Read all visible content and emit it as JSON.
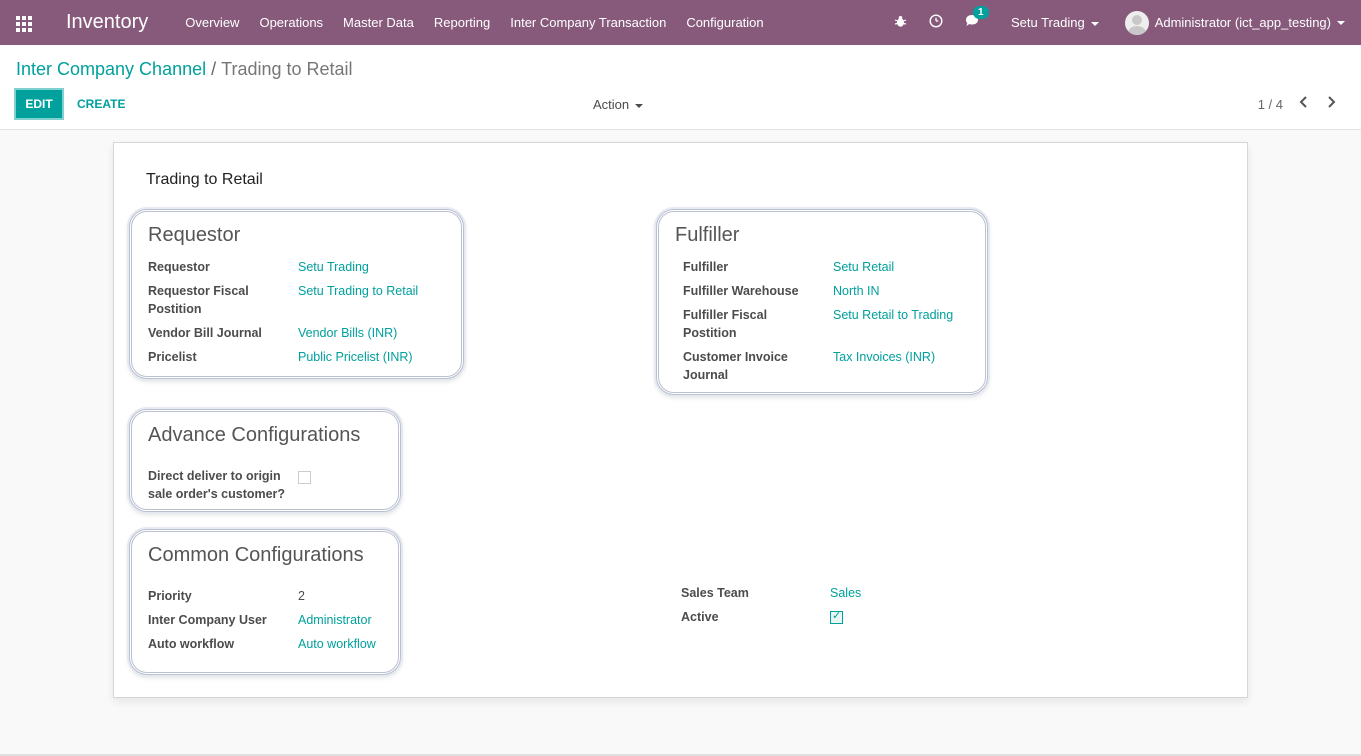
{
  "navbar": {
    "brand": "Inventory",
    "menu": [
      "Overview",
      "Operations",
      "Master Data",
      "Reporting",
      "Inter Company Transaction",
      "Configuration"
    ],
    "message_count": "1",
    "company": "Setu Trading",
    "user": "Administrator (ict_app_testing)",
    "accent_color": "#875a7b"
  },
  "breadcrumb": {
    "parent": "Inter Company Channel",
    "separator": "/",
    "current": "Trading to Retail"
  },
  "buttons": {
    "edit": "EDIT",
    "create": "CREATE",
    "action": "Action"
  },
  "pager": {
    "value": "1 / 4"
  },
  "record": {
    "title": "Trading to Retail"
  },
  "requestor_group": {
    "title": "Requestor",
    "fields": [
      {
        "label": "Requestor",
        "value": "Setu Trading"
      },
      {
        "label": "Requestor Fiscal Postition",
        "value": "Setu Trading to Retail"
      },
      {
        "label": "Vendor Bill Journal",
        "value": "Vendor Bills (INR)"
      },
      {
        "label": "Pricelist",
        "value": "Public Pricelist (INR)"
      }
    ]
  },
  "fulfiller_group": {
    "title": "Fulfiller",
    "fields": [
      {
        "label": "Fulfiller",
        "value": "Setu Retail"
      },
      {
        "label": "Fulfiller Warehouse",
        "value": "North IN"
      },
      {
        "label": "Fulfiller Fiscal Postition",
        "value": "Setu Retail to Trading"
      },
      {
        "label": "Customer Invoice Journal",
        "value": "Tax Invoices (INR)"
      }
    ]
  },
  "advance_group": {
    "title": "Advance Configurations",
    "fields": [
      {
        "label": "Direct deliver to origin sale order's customer?",
        "checked": false
      }
    ]
  },
  "common_group": {
    "title": "Common Configurations",
    "fields": [
      {
        "label": "Priority",
        "value": "2"
      },
      {
        "label": "Inter Company User",
        "value": "Administrator"
      },
      {
        "label": "Auto workflow",
        "value": "Auto workflow"
      }
    ],
    "right_fields": [
      {
        "label": "Sales Team",
        "value": "Sales"
      },
      {
        "label": "Active",
        "checked": true
      }
    ]
  }
}
